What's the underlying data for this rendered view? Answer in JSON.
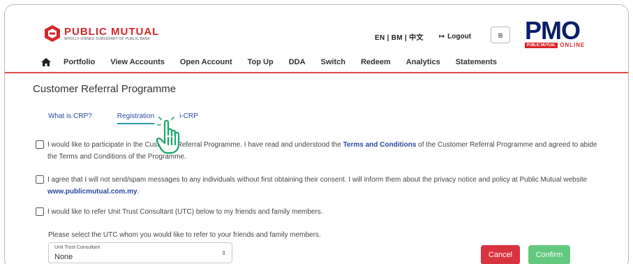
{
  "brand": {
    "name": "PUBLIC MUTUAL",
    "tagline": "WHOLLY-OWNED SUBSIDIARY OF PUBLIC BANK",
    "pmo_logo": "PMO",
    "pmo_bar_label": "PUBLIC MUTUAL",
    "pmo_bar_online": "ONLINE",
    "colors": {
      "red": "#d7262b",
      "navy": "#0b1e6b"
    }
  },
  "header": {
    "language_switch": "EN | BM | 中文",
    "logout_label": "Logout",
    "logout_icon": "logout-icon",
    "menu_icon": "hamburger-menu-icon",
    "menu_glyph": "≡"
  },
  "nav": {
    "home_icon": "home-icon",
    "items": [
      {
        "label": "Portfolio"
      },
      {
        "label": "View Accounts"
      },
      {
        "label": "Open Account"
      },
      {
        "label": "Top Up"
      },
      {
        "label": "DDA"
      },
      {
        "label": "Switch"
      },
      {
        "label": "Redeem"
      },
      {
        "label": "Analytics"
      },
      {
        "label": "Statements"
      }
    ]
  },
  "page": {
    "title": "Customer Referral Programme",
    "tabs": [
      {
        "label": "What is CRP?",
        "active": false
      },
      {
        "label": "Registration",
        "active": true
      },
      {
        "label": "i-CRP",
        "active": false
      }
    ],
    "pointer_icon": "hand-pointer-icon"
  },
  "agreements": {
    "row1": {
      "before": "I would like to participate in the Customer Referral Programme. I have read and understood the ",
      "link": "Terms and Conditions",
      "after": " of the Customer Referral Programme and agreed to abide the Terms and Conditions of the Programme.",
      "checked": false
    },
    "row2": {
      "before": "I agree that I will not send/spam messages to any individuals without first obtaining their consent. I will inform them about the privacy notice and policy at Public Mutual website ",
      "link": "www.publicmutual.com.my",
      "after": ".",
      "checked": false
    },
    "row3": {
      "text": "I would like to refer Unit Trust Consultant (UTC) below to my friends and family members.",
      "checked": false
    }
  },
  "utc_select": {
    "prompt": "Please select the UTC whom you would like to refer to your friends and family members.",
    "label": "Unit Trust Consultant",
    "value": "None",
    "arrow": "⇕"
  },
  "actions": {
    "cancel_label": "Cancel",
    "confirm_label": "Confirm",
    "cancel_color": "#d9333f",
    "confirm_color": "#62c97f"
  }
}
